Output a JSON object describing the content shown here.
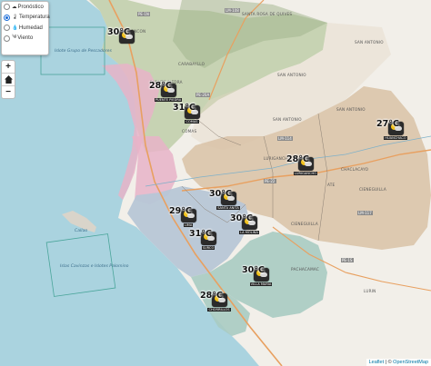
{
  "layers": {
    "items": [
      {
        "label": "Pronóstico",
        "icon": "cloud-icon",
        "selected": false
      },
      {
        "label": "Temperatura",
        "icon": "thermometer-icon",
        "selected": true
      },
      {
        "label": "Humedad",
        "icon": "drop-icon",
        "selected": false
      },
      {
        "label": "Viento",
        "icon": "wind-icon",
        "selected": false
      }
    ]
  },
  "zoom": {
    "in": "+",
    "out": "−"
  },
  "home_icon": "home-icon",
  "markers": [
    {
      "temp": "30°C",
      "icon": "partly-cloudy-icon"
    },
    {
      "temp": "28°C",
      "name": "PUENTE PIEDRA",
      "icon": "partly-cloudy-icon"
    },
    {
      "temp": "31°C",
      "name": "COMAS",
      "icon": "partly-cloudy-icon"
    },
    {
      "temp": "27°C",
      "name": "HUANCHACO",
      "icon": "partly-cloudy-icon"
    },
    {
      "temp": "28°C",
      "name": "LURIGANCHO",
      "icon": "partly-cloudy-icon"
    },
    {
      "temp": "30°C",
      "name": "SANTA ANITA",
      "icon": "partly-cloudy-icon"
    },
    {
      "temp": "29°C",
      "name": "LIMA",
      "icon": "partly-cloudy-icon"
    },
    {
      "temp": "30°C",
      "name": "LA MOLINA",
      "icon": "partly-cloudy-icon"
    },
    {
      "temp": "31°C",
      "name": "SURCO",
      "icon": "partly-cloudy-icon"
    },
    {
      "temp": "30°C",
      "name": "VILLA MARIA",
      "icon": "partly-cloudy-icon"
    },
    {
      "temp": "28°C",
      "name": "CHORRILLOS",
      "icon": "partly-cloudy-icon"
    }
  ],
  "places": {
    "santa_rosa": "SANTA ROSA DE QUIVES",
    "san_antonio_1": "SAN ANTONIO",
    "san_antonio_2": "SAN ANTONIO",
    "san_antonio_3": "SAN ANTONIO",
    "san_antonio_4": "SAN ANTONIO",
    "ancon": "ANCON",
    "carabayllo": "CARABAYLLO",
    "puente_piedra": "PUENTE PIEDRA",
    "comas": "COMAS",
    "lurigancho": "LURIGANCHO",
    "chaclacayo": "CHACLACAYO",
    "cieneguilla_1": "CIENEGUILLA",
    "cieneguilla_2": "CIENEGUILLA",
    "ate": "ATE",
    "pachacamac": "PACHACAMAC",
    "lurin": "LURIN",
    "callao": "Callao",
    "islas_pescadores": "Islote Grupo de Pescadores",
    "islas_cavinzas": "Islas Cavinzas e Islotes Palomino"
  },
  "road_tags": [
    "PE-1N",
    "LM-108",
    "PE-20A",
    "PE-22",
    "LM-117",
    "LM-114",
    "PE-1S"
  ],
  "attribution": {
    "leaflet": "Leaflet",
    "sep": " | © ",
    "osm": "OpenStreetMap"
  },
  "colors": {
    "sea": "#aad3df",
    "land": "#f2efe9",
    "zone_green": "#b8c9a0",
    "zone_pink": "#e8b3c8",
    "zone_brown": "#d9c2a6",
    "zone_blue": "#b7c6d6",
    "zone_teal": "#a9cbc2"
  }
}
